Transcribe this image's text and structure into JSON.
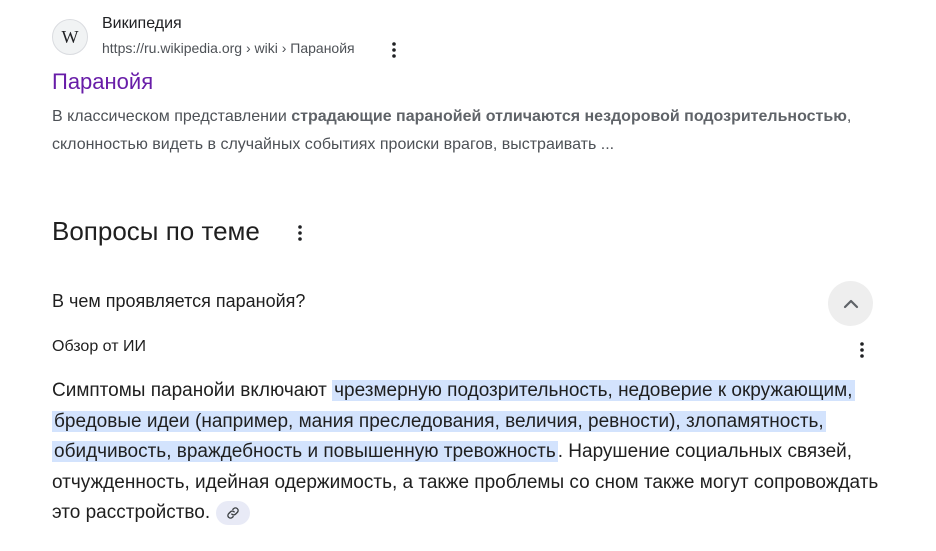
{
  "result": {
    "favicon_letter": "W",
    "site_name": "Википедия",
    "url": "https://ru.wikipedia.org › wiki › Паранойя",
    "title": "Паранойя",
    "snippet": {
      "pre": "В классическом представлении ",
      "bold1": "страдающие паранойей отличаются нездоровой подозрительностью",
      "post": ", склонностью видеть в случайных событиях происки врагов, выстраивать ..."
    }
  },
  "related": {
    "title": "Вопросы по теме",
    "question": "В чем проявляется паранойя?",
    "ai_label": "Обзор от ИИ",
    "answer": {
      "pre": "Симптомы паранойи включают ",
      "highlight": "чрезмерную подозрительность, недоверие к окружающим, бредовые идеи (например, мания преследования, величия, ревности), злопамятность, обидчивость, враждебность и повышенную тревожность",
      "post": ". Нарушение социальных связей, отчужденность, идейная одержимость, а также проблемы со сном также могут сопровождать это расстройство."
    }
  },
  "icons": {
    "menu": "vertical-dots-icon",
    "collapse": "chevron-up-icon",
    "link": "link-icon"
  },
  "colors": {
    "visited_link": "#681da8",
    "highlight": "#d3e3fd",
    "chip_background": "#eeeeee"
  }
}
